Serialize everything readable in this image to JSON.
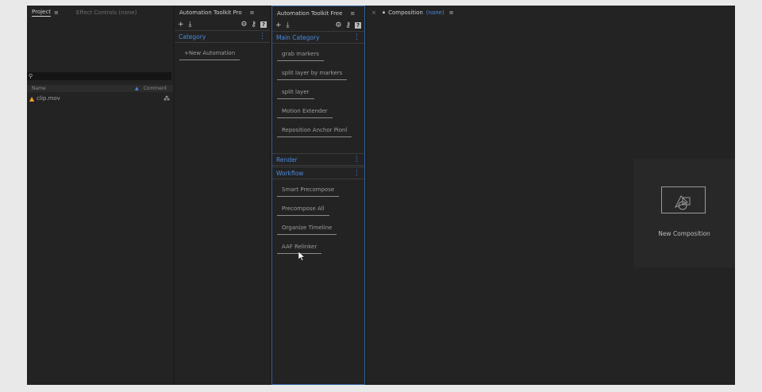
{
  "project_panel": {
    "tab_project": "Project",
    "tab_effect_controls": "Effect Controls (none)",
    "search_icon": "search-icon",
    "columns": {
      "name": "Name",
      "comment": "Comment"
    },
    "files": [
      {
        "name": "clip.mov",
        "icon": "footage-icon"
      }
    ]
  },
  "toolkit_pro": {
    "title": "Automation Toolkit Pro",
    "category_label": "Category",
    "buttons": [
      "+New Automation"
    ]
  },
  "toolkit_free": {
    "title": "Automation Toolkit Free",
    "main_category_label": "Main Category",
    "main_buttons": [
      "grab markers",
      "split layer by markers",
      "split layer",
      "Motion Extender",
      "Reposition Anchor Pionl"
    ],
    "render_label": "Render",
    "workflow_label": "Workflow",
    "workflow_buttons": [
      "Smart Precompose",
      "Precompose All",
      "Organize Timeline",
      "AAF Relinker"
    ]
  },
  "composition_panel": {
    "tab_label": "Composition",
    "tab_none": "(none)",
    "new_comp_label": "New Composition"
  },
  "colors": {
    "accent_blue": "#4b8be0",
    "panel_bg": "#232323",
    "outline_blue": "#2f5f9a"
  }
}
